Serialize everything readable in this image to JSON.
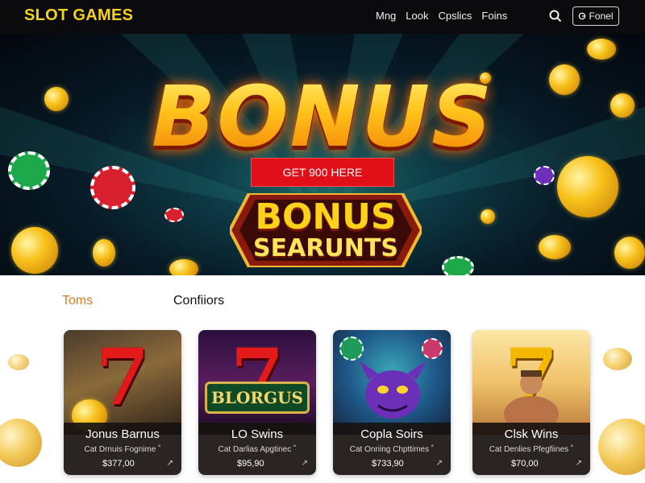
{
  "header": {
    "brand": "SLOT GAMES",
    "nav": [
      "Mng",
      "Look",
      "Cpslics",
      "Foins"
    ],
    "search_icon": "search-icon",
    "login_icon": "account-icon",
    "login_label": "Fonel"
  },
  "hero": {
    "title": "BONUS",
    "cta_label": "GET 900 HERE",
    "badge_line1": "BONUS",
    "badge_line2": "SEARUNTS"
  },
  "section": {
    "tabs": [
      "Toms",
      "Confiiors"
    ]
  },
  "games": [
    {
      "title": "Jonus Barnus",
      "subtitle": "Cat Drnuis Fognime ˚",
      "price": "$377,00",
      "art_text": ""
    },
    {
      "title": "LO Swins",
      "subtitle": "Cat Darlias Apgtinec ˚",
      "price": "$95,90",
      "art_text": "BLORGUS"
    },
    {
      "title": "Copla Soirs",
      "subtitle": "Cat Onriing Chpttimes ˚",
      "price": "$733,90",
      "art_text": ""
    },
    {
      "title": "Clsk Wins",
      "subtitle": "Cat Denlies Pfegfiines ˚",
      "price": "$70,00",
      "art_text": ""
    }
  ],
  "colors": {
    "brand": "#f6d21b",
    "accent_tab": "#e07a1c",
    "cta": "#e10f18",
    "header_bg": "#0b0b0d"
  }
}
